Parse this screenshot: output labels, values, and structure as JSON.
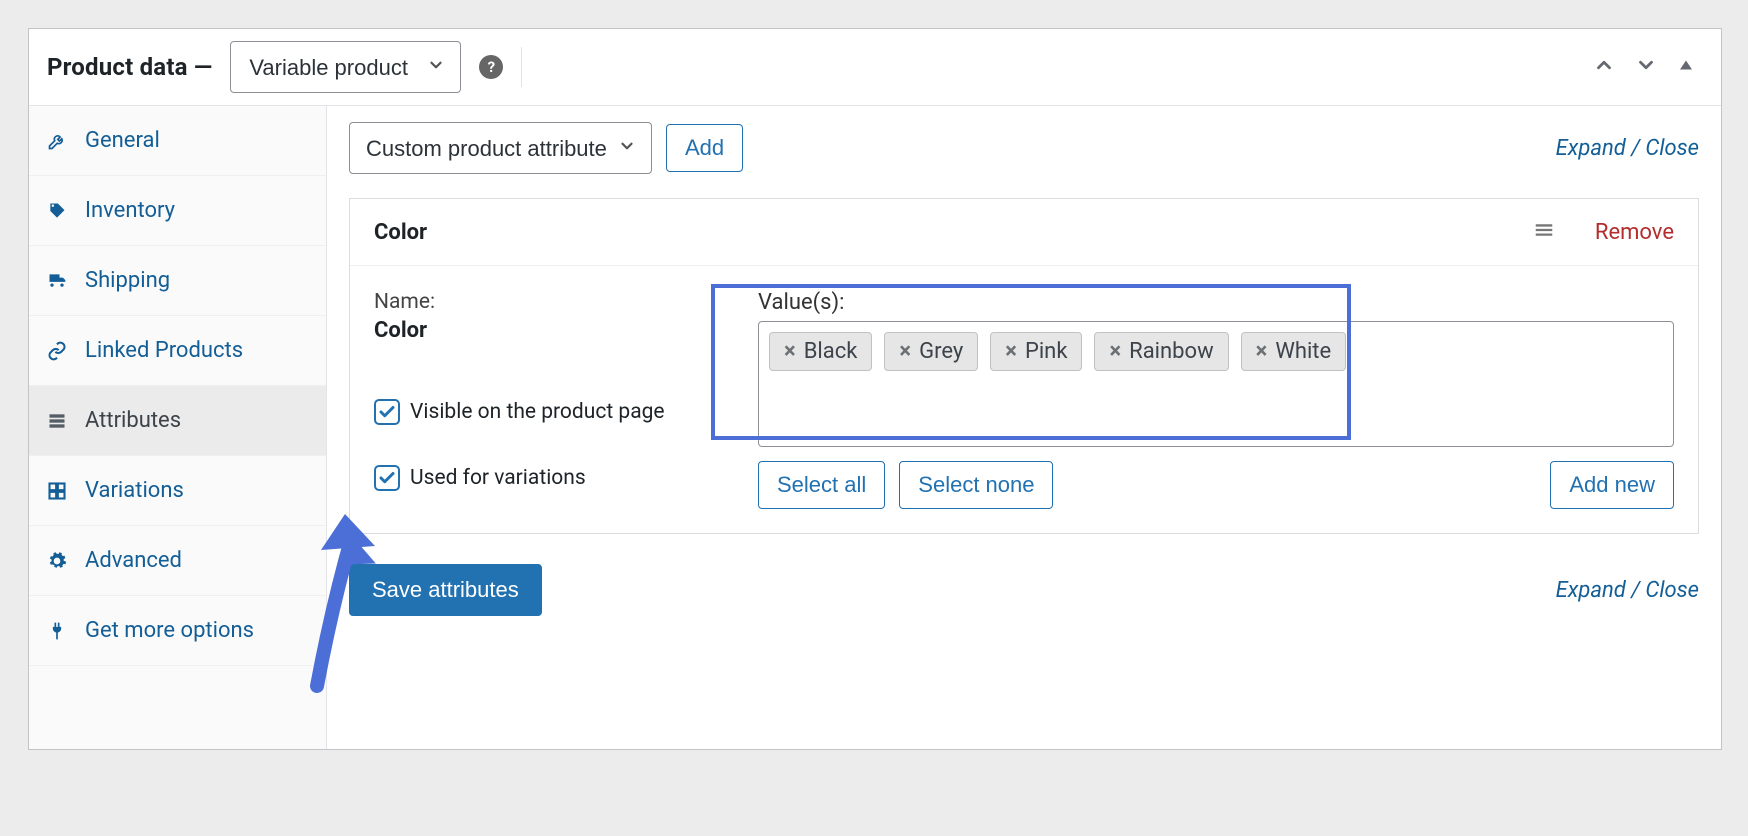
{
  "header": {
    "title": "Product data —",
    "product_type": "Variable product",
    "help_tooltip": "?"
  },
  "sidebar": {
    "items": [
      {
        "label": "General"
      },
      {
        "label": "Inventory"
      },
      {
        "label": "Shipping"
      },
      {
        "label": "Linked Products"
      },
      {
        "label": "Attributes"
      },
      {
        "label": "Variations"
      },
      {
        "label": "Advanced"
      },
      {
        "label": "Get more options"
      }
    ]
  },
  "main": {
    "attribute_select": "Custom product attribute",
    "add_button": "Add",
    "expand_close": "Expand / Close",
    "save_button": "Save attributes"
  },
  "attribute": {
    "title": "Color",
    "name_label": "Name:",
    "name_value": "Color",
    "visible_label": "Visible on the product page",
    "used_for_variations_label": "Used for variations",
    "values_label": "Value(s):",
    "tags": [
      "Black",
      "Grey",
      "Pink",
      "Rainbow",
      "White"
    ],
    "select_all": "Select all",
    "select_none": "Select none",
    "add_new": "Add new",
    "remove": "Remove"
  }
}
